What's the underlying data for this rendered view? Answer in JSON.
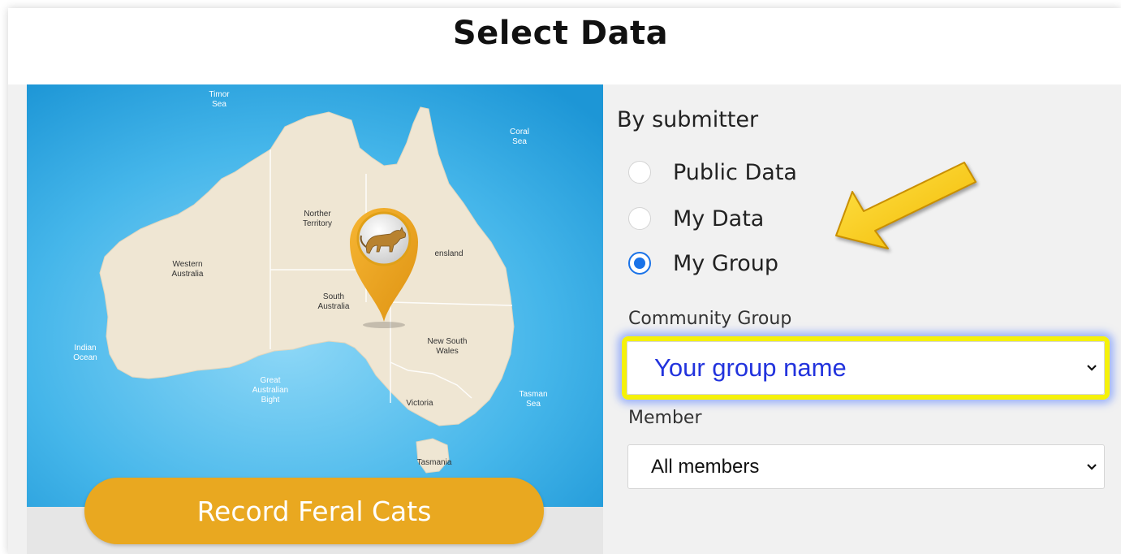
{
  "header": {
    "title": "Select Data"
  },
  "map": {
    "labels": {
      "timor_sea": [
        "Timor",
        "Sea"
      ],
      "coral_sea": [
        "Coral",
        "Sea"
      ],
      "northern_territory": [
        "Norther",
        "Territory"
      ],
      "queensland": "ensland",
      "western_australia": [
        "Western",
        "Australia"
      ],
      "south_australia": [
        "South",
        "Australia"
      ],
      "new_south_wales": [
        "New South",
        "Wales"
      ],
      "indian_ocean": [
        "Indian",
        "Ocean"
      ],
      "great_australian_bight": [
        "Great",
        "Australian",
        "Bight"
      ],
      "victoria": "Victoria",
      "tasman_sea": [
        "Tasman",
        "Sea"
      ],
      "tasmania": "Tasmania"
    },
    "pin_icon": "cat-pin-icon"
  },
  "record_button": {
    "label": "Record Feral Cats"
  },
  "filters": {
    "by_submitter_label": "By submitter",
    "options": [
      {
        "label": "Public Data",
        "checked": false
      },
      {
        "label": "My Data",
        "checked": false
      },
      {
        "label": "My Group",
        "checked": true
      }
    ],
    "community_group": {
      "label": "Community Group",
      "value": "Your group name"
    },
    "member": {
      "label": "Member",
      "value": "All members"
    }
  },
  "colors": {
    "accent": "#e9a820",
    "radio_checked": "#1a73e8",
    "highlight_border": "#f5f10a",
    "group_text": "#2233dd",
    "ocean": "#3aaee6",
    "land": "#efe6d3"
  }
}
